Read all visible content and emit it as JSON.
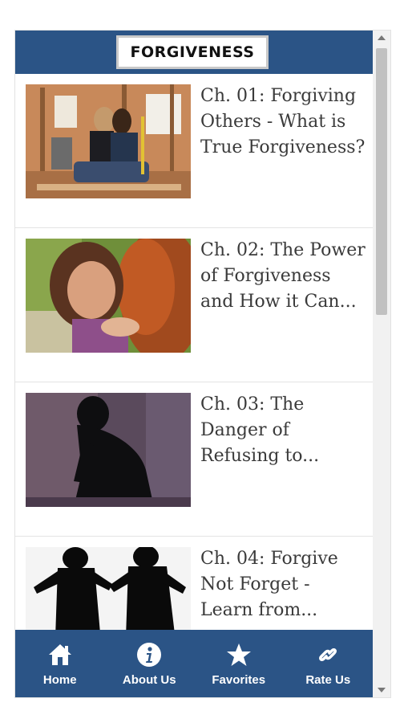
{
  "header": {
    "logo_text": "FORGIVENESS"
  },
  "chapters": [
    {
      "title": "Ch. 01: Forgiving Others - What is True Forgiveness?",
      "display": "Ch. 01: Forgiving\nOthers - What is\nTrue Forgiveness?"
    },
    {
      "title": "Ch. 02: The Power of Forgiveness and How it Can...",
      "display": "Ch. 02: The Power\nof Forgiveness\nand How it Can..."
    },
    {
      "title": "Ch. 03: The Danger of Refusing to...",
      "display": "Ch. 03: The\nDanger of\nRefusing to..."
    },
    {
      "title": "Ch. 04: Forgive Not Forget - Learn from...",
      "display": "Ch. 04: Forgive\nNot Forget -\nLearn from..."
    }
  ],
  "nav": [
    {
      "label": "Home",
      "icon": "home-icon"
    },
    {
      "label": "About Us",
      "icon": "info-icon"
    },
    {
      "label": "Favorites",
      "icon": "star-icon"
    },
    {
      "label": "Rate Us",
      "icon": "link-icon"
    }
  ],
  "colors": {
    "primary": "#2b5486",
    "text": "#3a3a3a"
  }
}
